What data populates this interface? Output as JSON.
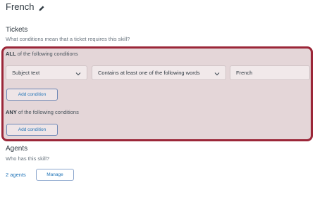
{
  "skill": {
    "name": "French"
  },
  "tickets": {
    "heading": "Tickets",
    "description": "What conditions mean that a ticket requires this skill?",
    "all_group": {
      "bold": "ALL",
      "rest": " of the following conditions",
      "condition": {
        "field": "Subject text",
        "operator": "Contains at least one of the following words",
        "value": "French"
      },
      "add_label": "Add condition"
    },
    "any_group": {
      "bold": "ANY",
      "rest": " of the following conditions",
      "add_label": "Add condition"
    }
  },
  "agents": {
    "heading": "Agents",
    "description": "Who has this skill?",
    "count_link": "2 agents",
    "manage_label": "Manage"
  },
  "colors": {
    "highlight_border": "#9b2638",
    "link": "#1f73b7"
  },
  "icons": {
    "edit": "pencil-icon",
    "dropdown": "chevron-down-icon"
  }
}
